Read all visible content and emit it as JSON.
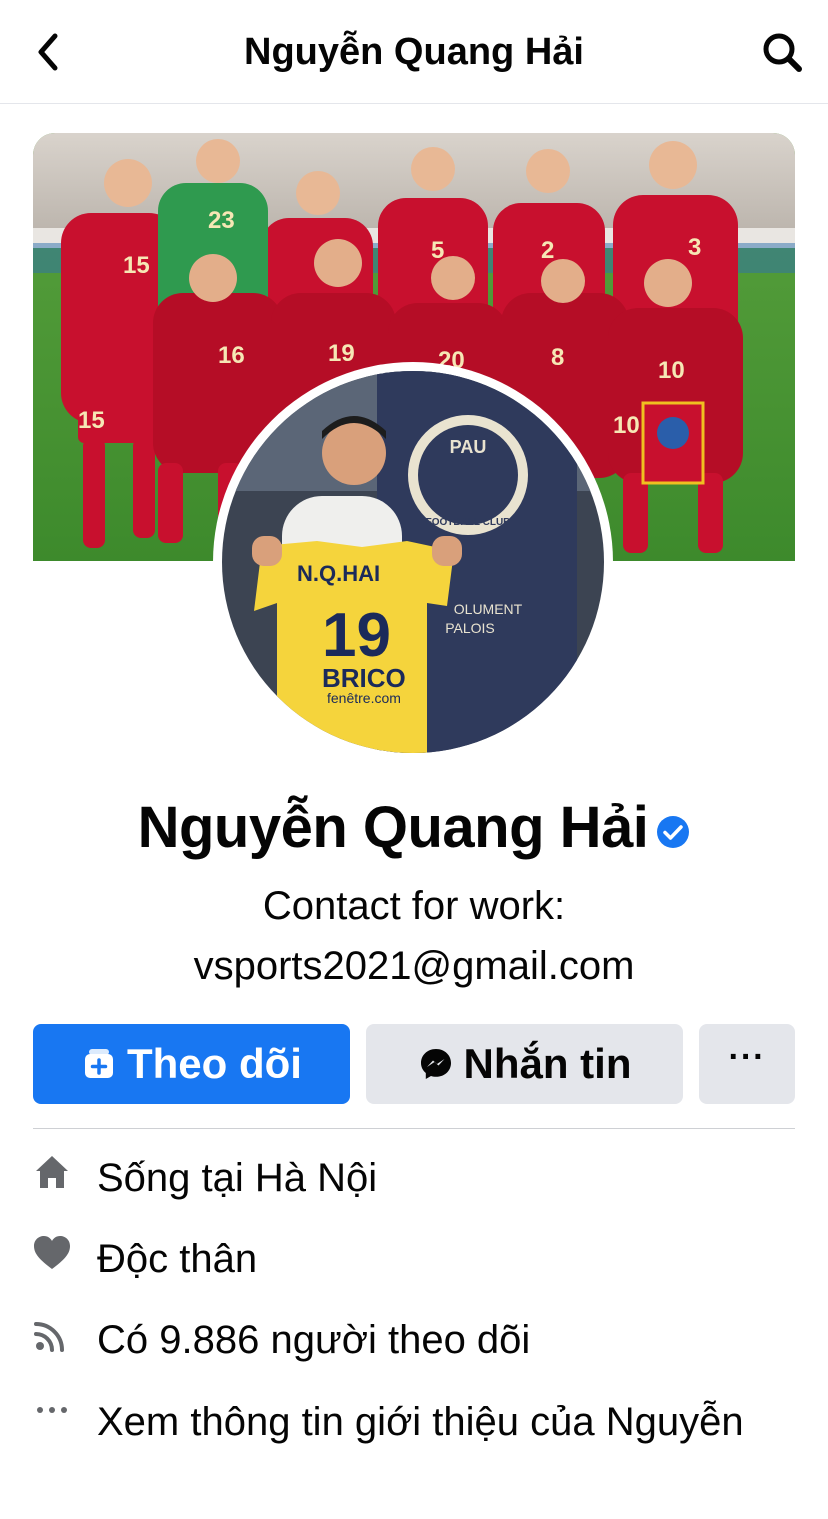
{
  "header": {
    "title": "Nguyễn Quang Hải"
  },
  "cover": {
    "jersey_numbers": [
      "15",
      "23",
      "5",
      "2",
      "3",
      "16",
      "19",
      "20",
      "8",
      "10",
      "15",
      "10"
    ]
  },
  "avatar": {
    "banner_line1": "PAU",
    "banner_line2": "FOOTBALL CLUB",
    "banner_line3": "OLUMENT",
    "banner_line4": "PALOIS",
    "shirt_name": "N.Q.HAI",
    "shirt_number": "19",
    "shirt_sponsor": "BRICO",
    "shirt_sponsor2": "fenêtre.com"
  },
  "profile": {
    "name": "Nguyễn Quang Hải",
    "bio_line1": "Contact for work:",
    "bio_line2": "vsports2021@gmail.com"
  },
  "actions": {
    "follow_label": "Theo dõi",
    "message_label": "Nhắn tin",
    "more_label": "···"
  },
  "info": {
    "lives_prefix": "Sống tại ",
    "lives_city": "Hà Nội",
    "relationship": "Độc thân",
    "followers": "Có 9.886 người theo dõi",
    "about": "Xem thông tin giới thiệu của Nguyễn"
  },
  "colors": {
    "accent": "#1877f2",
    "button_gray": "#e4e6eb",
    "jersey_red": "#c8102e",
    "shirt_yellow": "#f5d43c"
  }
}
